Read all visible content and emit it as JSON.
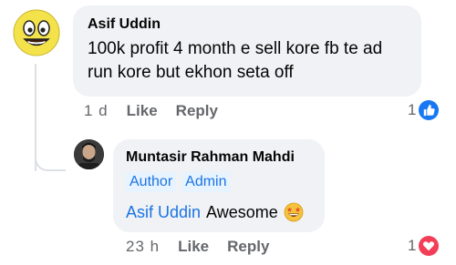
{
  "comment": {
    "author": "Asif Uddin",
    "text": "100k profit 4 month e sell kore fb te ad run kore but ekhon seta off",
    "time": "1 d",
    "like_label": "Like",
    "reply_label": "Reply",
    "reaction_count": "1",
    "reaction_icon": "like-icon",
    "reaction_color": "#1877f2"
  },
  "reply": {
    "author": "Muntasir Rahman Mahdi",
    "badges": [
      "Author",
      "Admin"
    ],
    "mention": "Asif Uddin",
    "text": "Awesome",
    "emoji": "grinning-face-with-stars-icon",
    "time": "23 h",
    "like_label": "Like",
    "reply_label": "Reply",
    "reaction_count": "1",
    "reaction_icon": "love-icon",
    "reaction_color": "#f33e58"
  },
  "colors": {
    "link_blue": "#1b74e4",
    "bubble_bg": "#f0f2f5",
    "meta_gray": "#65676b"
  }
}
